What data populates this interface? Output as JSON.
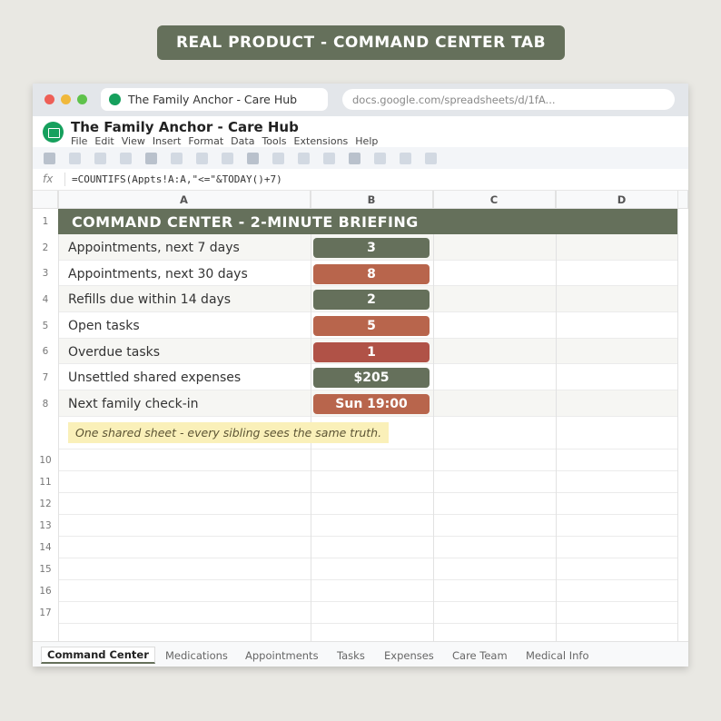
{
  "banner": "REAL PRODUCT - COMMAND CENTER TAB",
  "browser": {
    "tab_title": "The Family Anchor - Care Hub",
    "url": "docs.google.com/spreadsheets/d/1fA..."
  },
  "app": {
    "doc_title": "The Family Anchor - Care Hub",
    "menu": [
      "File",
      "Edit",
      "View",
      "Insert",
      "Format",
      "Data",
      "Tools",
      "Extensions",
      "Help"
    ]
  },
  "formula_bar": {
    "icon": "fx",
    "formula": "=COUNTIFS(Appts!A:A,\"<=\"&TODAY()+7)"
  },
  "columns": [
    "A",
    "B",
    "C",
    "D"
  ],
  "sheet": {
    "title": "COMMAND CENTER - 2-MINUTE BRIEFING",
    "rows": [
      {
        "label": "Appointments, next 7 days",
        "value": "3",
        "color": "#65705b"
      },
      {
        "label": "Appointments, next 30 days",
        "value": "8",
        "color": "#b8654c"
      },
      {
        "label": "Refills due within 14 days",
        "value": "2",
        "color": "#65705b"
      },
      {
        "label": "Open tasks",
        "value": "5",
        "color": "#b8654c"
      },
      {
        "label": "Overdue tasks",
        "value": "1",
        "color": "#b05247"
      },
      {
        "label": "Unsettled shared expenses",
        "value": "$205",
        "color": "#65705b"
      },
      {
        "label": "Next family check-in",
        "value": "Sun 19:00",
        "color": "#b8654c"
      }
    ],
    "note": "One shared sheet - every sibling sees the same truth.",
    "row_numbers": [
      "1",
      "2",
      "3",
      "4",
      "5",
      "6",
      "7",
      "8",
      "10",
      "11",
      "12",
      "13",
      "14",
      "15",
      "16",
      "17"
    ]
  },
  "sheet_tabs": [
    "Command Center",
    "Medications",
    "Appointments",
    "Tasks",
    "Expenses",
    "Care Team",
    "Medical Info"
  ],
  "active_tab": "Command Center",
  "colors": {
    "accent_green": "#65705b",
    "accent_rust": "#b8654c",
    "accent_red": "#b05247",
    "note_bg": "#faf0b9"
  }
}
